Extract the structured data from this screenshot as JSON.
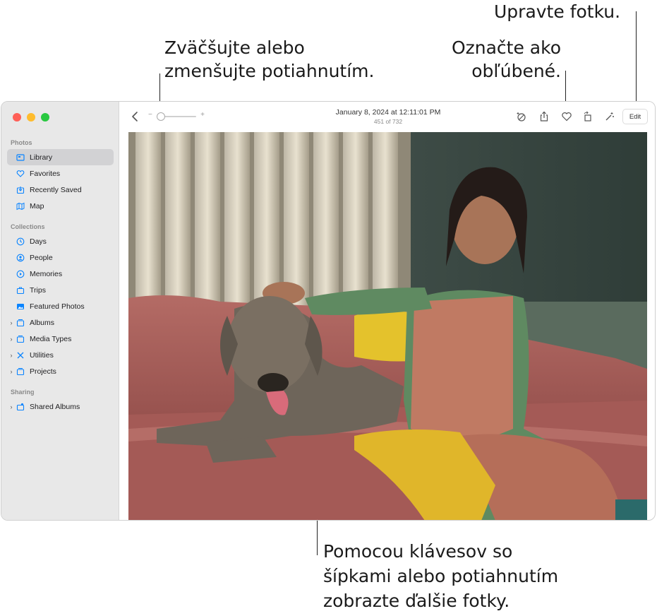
{
  "callouts": {
    "edit": [
      "Upravte fotku."
    ],
    "zoom": [
      "Zväčšujte alebo",
      "zmenšujte potiahnutím."
    ],
    "favorite": [
      "Označte ako",
      "obľúbené."
    ],
    "navigate": [
      "Pomocou klávesov so",
      "šípkami alebo potiahnutím",
      "zobrazte ďalšie fotky."
    ]
  },
  "sidebar": {
    "sections": [
      {
        "title": "Photos",
        "items": [
          {
            "label": "Library",
            "icon": "library-icon",
            "selected": true
          },
          {
            "label": "Favorites",
            "icon": "heart-icon"
          },
          {
            "label": "Recently Saved",
            "icon": "recently-saved-icon"
          },
          {
            "label": "Map",
            "icon": "map-icon"
          }
        ]
      },
      {
        "title": "Collections",
        "items": [
          {
            "label": "Days",
            "icon": "clock-icon"
          },
          {
            "label": "People",
            "icon": "person-icon"
          },
          {
            "label": "Memories",
            "icon": "memories-icon"
          },
          {
            "label": "Trips",
            "icon": "suitcase-icon"
          },
          {
            "label": "Featured Photos",
            "icon": "photo-icon"
          },
          {
            "label": "Albums",
            "icon": "album-icon",
            "expandable": true
          },
          {
            "label": "Media Types",
            "icon": "album-icon",
            "expandable": true
          },
          {
            "label": "Utilities",
            "icon": "utilities-icon",
            "expandable": true
          },
          {
            "label": "Projects",
            "icon": "album-icon",
            "expandable": true
          }
        ]
      },
      {
        "title": "Sharing",
        "items": [
          {
            "label": "Shared Albums",
            "icon": "shared-album-icon",
            "expandable": true
          }
        ]
      }
    ]
  },
  "toolbar": {
    "date": "January 8, 2024 at 12:11:01 PM",
    "count": "451 of 732",
    "zoom_minus": "−",
    "zoom_plus": "+",
    "edit_label": "Edit"
  },
  "colors": {
    "sidebar_bg": "#e8e8e8",
    "selected_bg": "#d2d2d4",
    "accent": "#0a84ff"
  }
}
